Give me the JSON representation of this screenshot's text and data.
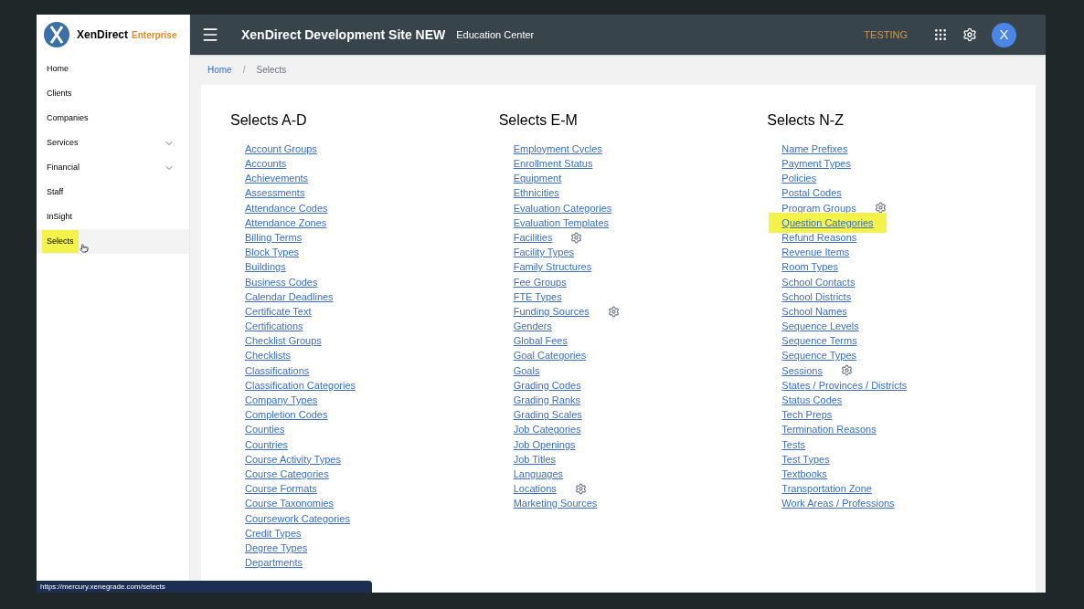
{
  "brand": {
    "name": "XenDirect",
    "edition": "Enterprise"
  },
  "header": {
    "title": "XenDirect Development Site NEW",
    "subtitle": "Education Center",
    "environment": "TESTING",
    "avatar": "X"
  },
  "sidebar": {
    "items": [
      {
        "label": "Home",
        "expandable": false,
        "selected": false
      },
      {
        "label": "Clients",
        "expandable": false,
        "selected": false
      },
      {
        "label": "Companies",
        "expandable": false,
        "selected": false
      },
      {
        "label": "Services",
        "expandable": true,
        "selected": false
      },
      {
        "label": "Financial",
        "expandable": true,
        "selected": false
      },
      {
        "label": "Staff",
        "expandable": false,
        "selected": false
      },
      {
        "label": "InSight",
        "expandable": false,
        "selected": false
      },
      {
        "label": "Selects",
        "expandable": false,
        "selected": true
      }
    ]
  },
  "breadcrumb_separator": "/",
  "breadcrumb": [
    {
      "label": "Home",
      "link": true
    },
    {
      "label": "Selects",
      "link": false
    }
  ],
  "columns": [
    {
      "title": "Selects A-D",
      "links": [
        {
          "label": "Account Groups",
          "gear": false,
          "highlighted": false
        },
        {
          "label": "Accounts",
          "gear": false,
          "highlighted": false
        },
        {
          "label": "Achievements",
          "gear": false,
          "highlighted": false
        },
        {
          "label": "Assessments",
          "gear": false,
          "highlighted": false
        },
        {
          "label": "Attendance Codes",
          "gear": false,
          "highlighted": false
        },
        {
          "label": "Attendance Zones",
          "gear": false,
          "highlighted": false
        },
        {
          "label": "Billing Terms",
          "gear": false,
          "highlighted": false
        },
        {
          "label": "Block Types",
          "gear": false,
          "highlighted": false
        },
        {
          "label": "Buildings",
          "gear": false,
          "highlighted": false
        },
        {
          "label": "Business Codes",
          "gear": false,
          "highlighted": false
        },
        {
          "label": "Calendar Deadlines",
          "gear": false,
          "highlighted": false
        },
        {
          "label": "Certificate Text",
          "gear": false,
          "highlighted": false
        },
        {
          "label": "Certifications",
          "gear": false,
          "highlighted": false
        },
        {
          "label": "Checklist Groups",
          "gear": false,
          "highlighted": false
        },
        {
          "label": "Checklists",
          "gear": false,
          "highlighted": false
        },
        {
          "label": "Classifications",
          "gear": false,
          "highlighted": false
        },
        {
          "label": "Classification Categories",
          "gear": false,
          "highlighted": false
        },
        {
          "label": "Company Types",
          "gear": false,
          "highlighted": false
        },
        {
          "label": "Completion Codes",
          "gear": false,
          "highlighted": false
        },
        {
          "label": "Counties",
          "gear": false,
          "highlighted": false
        },
        {
          "label": "Countries",
          "gear": false,
          "highlighted": false
        },
        {
          "label": "Course Activity Types",
          "gear": false,
          "highlighted": false
        },
        {
          "label": "Course Categories",
          "gear": false,
          "highlighted": false
        },
        {
          "label": "Course Formats",
          "gear": false,
          "highlighted": false
        },
        {
          "label": "Course Taxonomies",
          "gear": false,
          "highlighted": false
        },
        {
          "label": "Coursework Categories",
          "gear": false,
          "highlighted": false
        },
        {
          "label": "Credit Types",
          "gear": false,
          "highlighted": false
        },
        {
          "label": "Degree Types",
          "gear": false,
          "highlighted": false
        },
        {
          "label": "Departments",
          "gear": false,
          "highlighted": false
        }
      ]
    },
    {
      "title": "Selects E-M",
      "links": [
        {
          "label": "Employment Cycles",
          "gear": false,
          "highlighted": false
        },
        {
          "label": "Enrollment Status",
          "gear": false,
          "highlighted": false
        },
        {
          "label": "Equipment",
          "gear": false,
          "highlighted": false
        },
        {
          "label": "Ethnicities",
          "gear": false,
          "highlighted": false
        },
        {
          "label": "Evaluation Categories",
          "gear": false,
          "highlighted": false
        },
        {
          "label": "Evaluation Templates",
          "gear": false,
          "highlighted": false
        },
        {
          "label": "Facilities",
          "gear": true,
          "highlighted": false
        },
        {
          "label": "Facility Types",
          "gear": false,
          "highlighted": false
        },
        {
          "label": "Family Structures",
          "gear": false,
          "highlighted": false
        },
        {
          "label": "Fee Groups",
          "gear": false,
          "highlighted": false
        },
        {
          "label": "FTE Types",
          "gear": false,
          "highlighted": false
        },
        {
          "label": "Funding Sources",
          "gear": true,
          "highlighted": false
        },
        {
          "label": "Genders",
          "gear": false,
          "highlighted": false
        },
        {
          "label": "Global Fees",
          "gear": false,
          "highlighted": false
        },
        {
          "label": "Goal Categories",
          "gear": false,
          "highlighted": false
        },
        {
          "label": "Goals",
          "gear": false,
          "highlighted": false
        },
        {
          "label": "Grading Codes",
          "gear": false,
          "highlighted": false
        },
        {
          "label": "Grading Ranks",
          "gear": false,
          "highlighted": false
        },
        {
          "label": "Grading Scales",
          "gear": false,
          "highlighted": false
        },
        {
          "label": "Job Categories",
          "gear": false,
          "highlighted": false
        },
        {
          "label": "Job Openings",
          "gear": false,
          "highlighted": false
        },
        {
          "label": "Job Titles",
          "gear": false,
          "highlighted": false
        },
        {
          "label": "Languages",
          "gear": false,
          "highlighted": false
        },
        {
          "label": "Locations",
          "gear": true,
          "highlighted": false
        },
        {
          "label": "Marketing Sources",
          "gear": false,
          "highlighted": false
        }
      ]
    },
    {
      "title": "Selects N-Z",
      "links": [
        {
          "label": "Name Prefixes",
          "gear": false,
          "highlighted": false
        },
        {
          "label": "Payment Types",
          "gear": false,
          "highlighted": false
        },
        {
          "label": "Policies",
          "gear": false,
          "highlighted": false
        },
        {
          "label": "Postal Codes",
          "gear": false,
          "highlighted": false
        },
        {
          "label": "Program Groups",
          "gear": true,
          "highlighted": false
        },
        {
          "label": "Question Categories",
          "gear": false,
          "highlighted": true
        },
        {
          "label": "Refund Reasons",
          "gear": false,
          "highlighted": false
        },
        {
          "label": "Revenue Items",
          "gear": false,
          "highlighted": false
        },
        {
          "label": "Room Types",
          "gear": false,
          "highlighted": false
        },
        {
          "label": "School Contacts",
          "gear": false,
          "highlighted": false
        },
        {
          "label": "School Districts",
          "gear": false,
          "highlighted": false
        },
        {
          "label": "School Names",
          "gear": false,
          "highlighted": false
        },
        {
          "label": "Sequence Levels",
          "gear": false,
          "highlighted": false
        },
        {
          "label": "Sequence Terms",
          "gear": false,
          "highlighted": false
        },
        {
          "label": "Sequence Types",
          "gear": false,
          "highlighted": false
        },
        {
          "label": "Sessions",
          "gear": true,
          "highlighted": false
        },
        {
          "label": "States / Provinces / Districts",
          "gear": false,
          "highlighted": false
        },
        {
          "label": "Status Codes",
          "gear": false,
          "highlighted": false
        },
        {
          "label": "Tech Preps",
          "gear": false,
          "highlighted": false
        },
        {
          "label": "Termination Reasons",
          "gear": false,
          "highlighted": false
        },
        {
          "label": "Tests",
          "gear": false,
          "highlighted": false
        },
        {
          "label": "Test Types",
          "gear": false,
          "highlighted": false
        },
        {
          "label": "Textbooks",
          "gear": false,
          "highlighted": false
        },
        {
          "label": "Transportation Zone",
          "gear": false,
          "highlighted": false
        },
        {
          "label": "Work Areas / Professions",
          "gear": false,
          "highlighted": false
        }
      ]
    }
  ],
  "status_url": "https://mercury.xenegrade.com/selects"
}
